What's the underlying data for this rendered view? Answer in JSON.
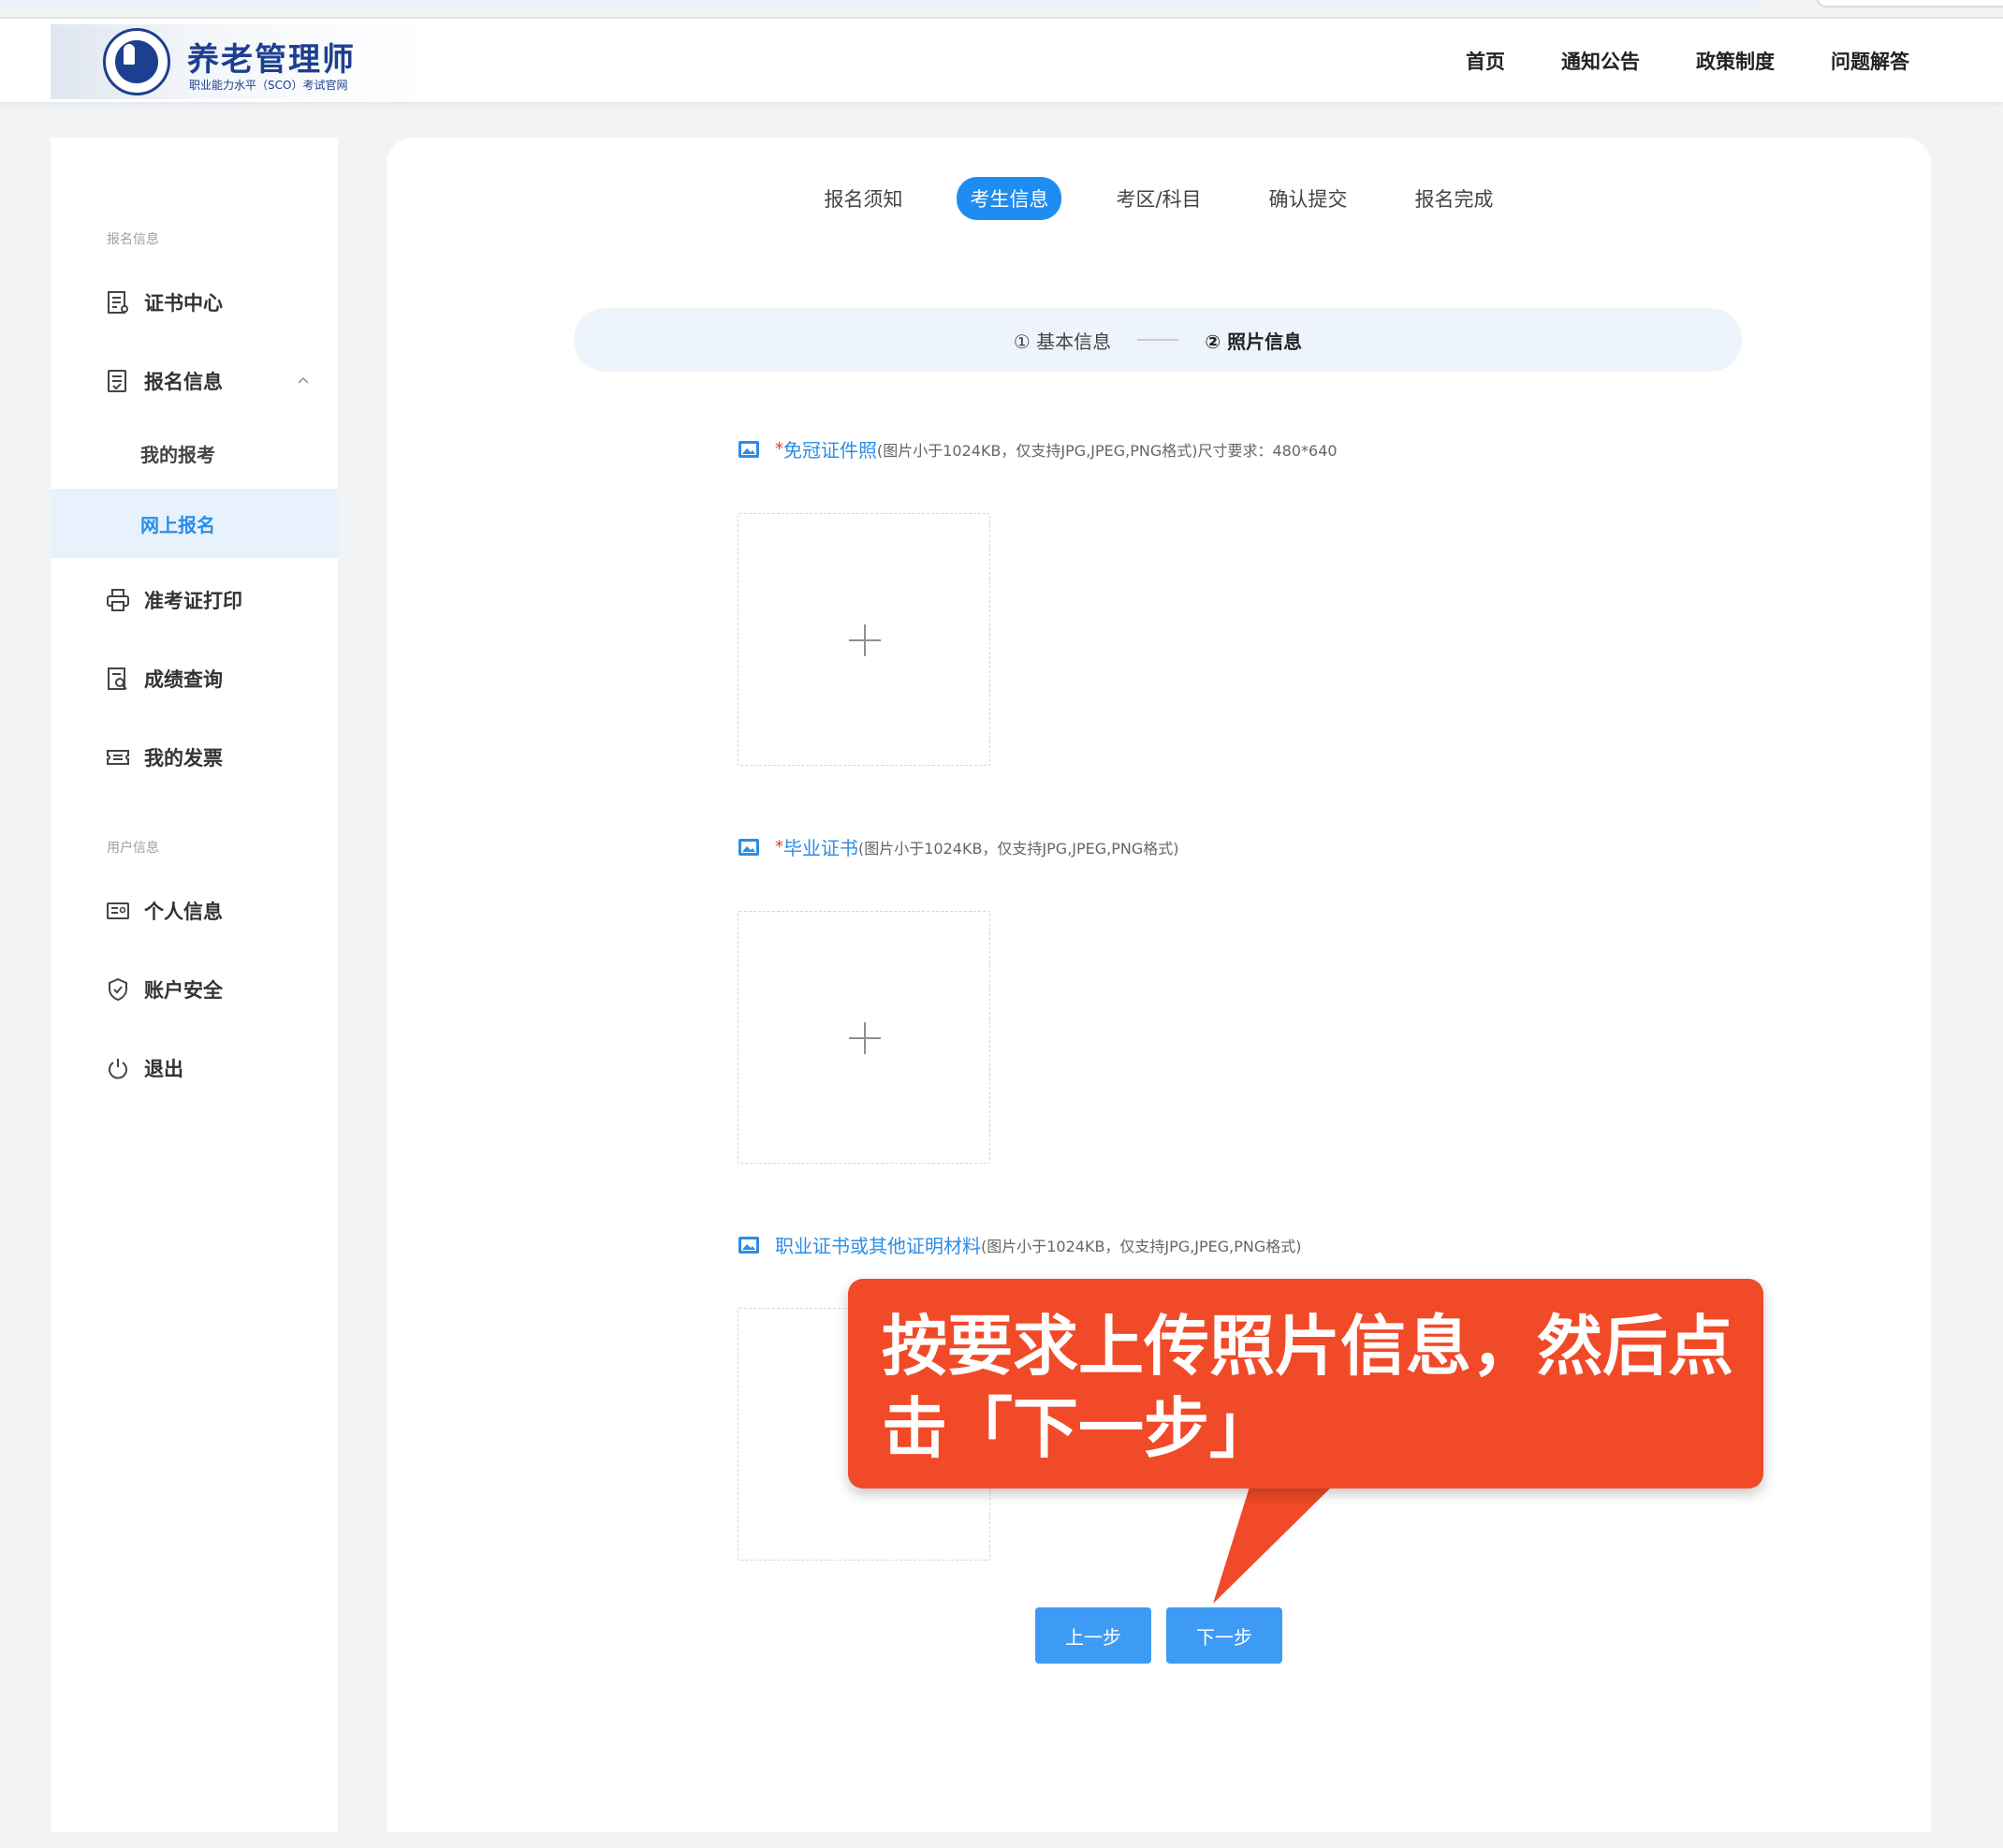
{
  "header": {
    "logo_title": "养老管理师",
    "logo_subtitle": "职业能力水平（SCO）考试官网",
    "nav": [
      "首页",
      "通知公告",
      "政策制度",
      "问题解答"
    ]
  },
  "sidebar": {
    "section_registration": "报名信息",
    "cert_center": "证书中心",
    "registration_info": "报名信息",
    "my_exams": "我的报考",
    "online_registration": "网上报名",
    "admission_print": "准考证打印",
    "score_query": "成绩查询",
    "my_invoice": "我的发票",
    "section_user": "用户信息",
    "personal_info": "个人信息",
    "account_security": "账户安全",
    "logout": "退出"
  },
  "tabs": [
    "报名须知",
    "考生信息",
    "考区/科目",
    "确认提交",
    "报名完成"
  ],
  "active_tab_index": 1,
  "steps": {
    "step1": "① 基本信息",
    "step2": "② 照片信息"
  },
  "uploads": [
    {
      "required": "*",
      "name": "免冠证件照",
      "hint": "(图片小于1024KB，仅支持JPG,JPEG,PNG格式)尺寸要求：480*640"
    },
    {
      "required": "*",
      "name": "毕业证书",
      "hint": "(图片小于1024KB，仅支持JPG,JPEG,PNG格式)"
    },
    {
      "required": "",
      "name": "职业证书或其他证明材料",
      "hint": "(图片小于1024KB，仅支持JPG,JPEG,PNG格式)"
    }
  ],
  "buttons": {
    "prev": "上一步",
    "next": "下一步"
  },
  "callout": {
    "text": "按要求上传照片信息，然后点击「下一步」"
  },
  "colors": {
    "accent": "#1e8cf0",
    "callout": "#f04a28",
    "brand": "#1d3f8f"
  }
}
